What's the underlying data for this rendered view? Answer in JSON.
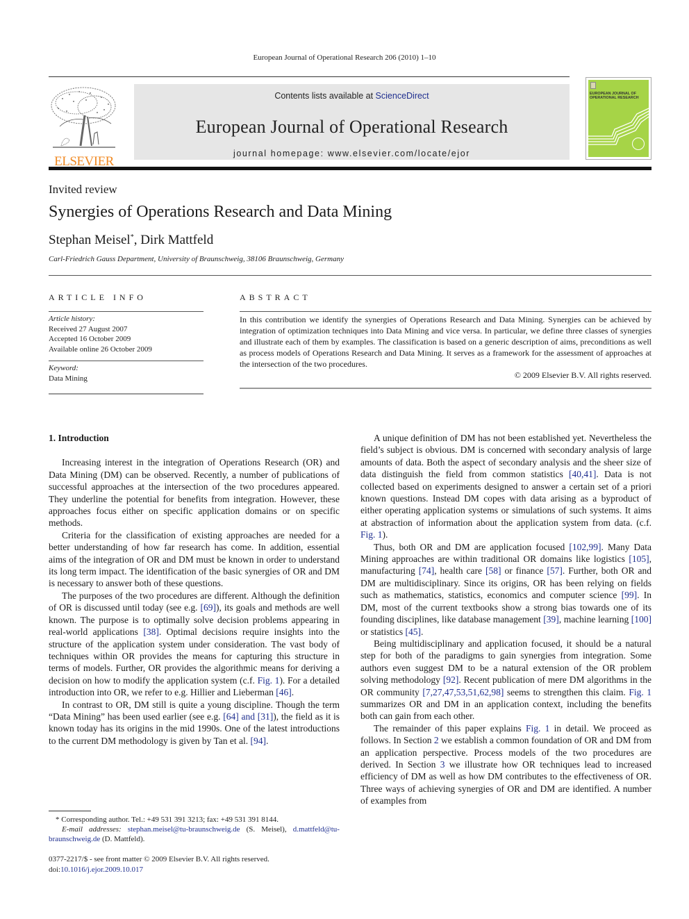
{
  "running_head": "European Journal of Operational Research 206 (2010) 1–10",
  "masthead": {
    "publisher": "ELSEVIER",
    "contents_prefix": "Contents lists available at ",
    "contents_link": "ScienceDirect",
    "journal_name": "European Journal of Operational Research",
    "homepage": "journal homepage: www.elsevier.com/locate/ejor",
    "cover_title_line1": "EUROPEAN JOURNAL OF",
    "cover_title_line2": "OPERATIONAL RESEARCH",
    "cover_accent": "#a6d447",
    "publisher_color": "#f08a24"
  },
  "article": {
    "type": "Invited review",
    "title": "Synergies of Operations Research and Data Mining",
    "author1": "Stephan Meisel",
    "author1_mark": "*",
    "author_sep": ", ",
    "author2": "Dirk Mattfeld",
    "affiliation": "Carl-Friedrich Gauss Department, University of Braunschweig, 38106 Braunschweig, Germany"
  },
  "article_info": {
    "heading": "ARTICLE INFO",
    "history_label": "Article history:",
    "received": "Received 27 August 2007",
    "accepted": "Accepted 16 October 2009",
    "online": "Available online 26 October 2009",
    "keyword_label": "Keyword:",
    "keyword": "Data Mining"
  },
  "abstract": {
    "heading": "ABSTRACT",
    "text": "In this contribution we identify the synergies of Operations Research and Data Mining. Synergies can be achieved by integration of optimization techniques into Data Mining and vice versa. In particular, we define three classes of synergies and illustrate each of them by examples. The classification is based on a generic description of aims, preconditions as well as process models of Operations Research and Data Mining. It serves as a framework for the assessment of approaches at the intersection of the two procedures.",
    "copyright": "© 2009 Elsevier B.V. All rights reserved."
  },
  "body": {
    "section1_heading": "1. Introduction",
    "left": {
      "p1": "Increasing interest in the integration of Operations Research (OR) and Data Mining (DM) can be observed. Recently, a number of publications of successful approaches at the intersection of the two procedures appeared. They underline the potential for benefits from integration. However, these approaches focus either on specific application domains or on specific methods.",
      "p2": "Criteria for the classification of existing approaches are needed for a better understanding of how far research has come. In addition, essential aims of the integration of OR and DM must be known in order to understand its long term impact. The identification of the basic synergies of OR and DM is necessary to answer both of these questions.",
      "p3_a": "The purposes of the two procedures are different. Although the definition of OR is discussed until today (see e.g. ",
      "p3_ref1": "[69]",
      "p3_b": "), its goals and methods are well known. The purpose is to optimally solve decision problems appearing in real-world applications ",
      "p3_ref2": "[38]",
      "p3_c": ". Optimal decisions require insights into the structure of the application system under consideration. The vast body of techniques within OR provides the means for capturing this structure in terms of models. Further, OR provides the algorithmic means for deriving a decision on how to modify the application system (c.f. ",
      "p3_fig": "Fig. 1",
      "p3_d": "). For a detailed introduction into OR, we refer to e.g. Hillier and Lieberman ",
      "p3_ref3": "[46]",
      "p3_e": ".",
      "p4_a": "In contrast to OR, DM still is quite a young discipline. Though the term “Data Mining” has been used earlier (see e.g. ",
      "p4_ref1": "[64] and [31]",
      "p4_b": "), the field as it is known today has its origins in the mid 1990s. One of the latest introductions to the current DM methodology is given by Tan et al. ",
      "p4_ref2": "[94]",
      "p4_c": "."
    },
    "right": {
      "p1_a": "A unique definition of DM has not been established yet. Nevertheless the field’s subject is obvious. DM is concerned with secondary analysis of large amounts of data. Both the aspect of secondary analysis and the sheer size of data distinguish the field from common statistics ",
      "p1_ref1": "[40,41]",
      "p1_b": ". Data is not collected based on experiments designed to answer a certain set of a priori known questions. Instead DM copes with data arising as a byproduct of either operating application systems or simulations of such systems. It aims at abstraction of information about the application system from data. (c.f. ",
      "p1_fig": "Fig. 1",
      "p1_c": ").",
      "p2_a": "Thus, both OR and DM are application focused ",
      "p2_ref1": "[102,99]",
      "p2_b": ". Many Data Mining approaches are within traditional OR domains like logistics ",
      "p2_ref2": "[105]",
      "p2_c": ", manufacturing ",
      "p2_ref3": "[74]",
      "p2_d": ", health care ",
      "p2_ref4": "[58]",
      "p2_e": " or finance ",
      "p2_ref5": "[57]",
      "p2_f": ". Further, both OR and DM are multidisciplinary. Since its origins, OR has been relying on fields such as mathematics, statistics, economics and computer science ",
      "p2_ref6": "[99]",
      "p2_g": ". In DM, most of the current textbooks show a strong bias towards one of its founding disciplines, like database management ",
      "p2_ref7": "[39]",
      "p2_h": ", machine learning ",
      "p2_ref8": "[100]",
      "p2_i": " or statistics ",
      "p2_ref9": "[45]",
      "p2_j": ".",
      "p3_a": "Being multidisciplinary and application focused, it should be a natural step for both of the paradigms to gain synergies from integration. Some authors even suggest DM to be a natural extension of the OR problem solving methodology ",
      "p3_ref1": "[92]",
      "p3_b": ". Recent publication of mere DM algorithms in the OR community ",
      "p3_ref2": "[7,27,47,53,51,62,98]",
      "p3_c": " seems to strengthen this claim. ",
      "p3_fig": "Fig. 1",
      "p3_d": " summarizes OR and DM in an application context, including the benefits both can gain from each other.",
      "p4_a": "The remainder of this paper explains ",
      "p4_fig": "Fig. 1",
      "p4_b": " in detail. We proceed as follows. In Section ",
      "p4_sec2": "2",
      "p4_c": " we establish a common foundation of OR and DM from an application perspective. Process models of the two procedures are derived. In Section ",
      "p4_sec3": "3",
      "p4_d": " we illustrate how OR techniques lead to increased efficiency of DM as well as how DM contributes to the effectiveness of OR. Three ways of achieving synergies of OR and DM are identified. A number of examples from"
    }
  },
  "footnotes": {
    "mark": "*",
    "corresponding": " Corresponding author. Tel.: +49 531 391 3213; fax: +49 531 391 8144.",
    "email_label": "E-mail addresses:",
    "email1": "stephan.meisel@tu-braunschweig.de",
    "email1_who": " (S. Meisel), ",
    "email2": "d.mattfeld@tu-braunschweig.de",
    "email2_who": " (D. Mattfeld)."
  },
  "front_matter": {
    "issn_line": "0377-2217/$ - see front matter © 2009 Elsevier B.V. All rights reserved.",
    "doi_prefix": "doi:",
    "doi": "10.1016/j.ejor.2009.10.017"
  }
}
